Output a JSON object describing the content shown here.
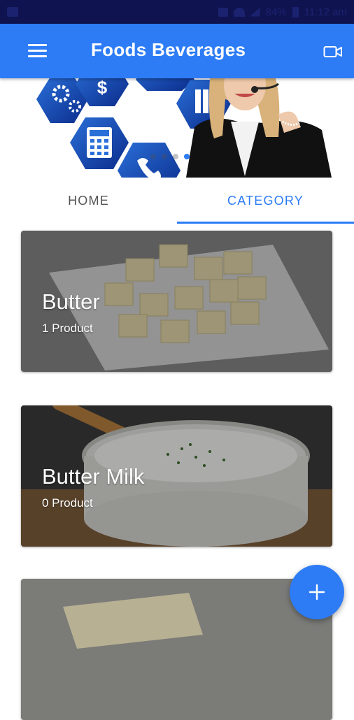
{
  "status_bar": {
    "icons": [
      "image-icon",
      "mute-icon",
      "wifi-icon",
      "signal-icon",
      "battery-icon"
    ],
    "battery": "84%",
    "time": "11:12 am"
  },
  "app_bar": {
    "title": "Foods Beverages",
    "menu_icon": "hamburger-menu-icon",
    "action_icon": "video-camera-icon",
    "color": "#2d7cf6"
  },
  "banner": {
    "icons": [
      "gears-icon",
      "dollar-icon",
      "calculator-icon",
      "binders-icon",
      "phone-icon"
    ],
    "slide_count": 4,
    "active_slide": 4
  },
  "tabs": [
    {
      "label": "HOME",
      "active": false
    },
    {
      "label": "CATEGORY",
      "active": true
    }
  ],
  "categories": [
    {
      "title": "Butter",
      "subtitle": "1 Product"
    },
    {
      "title": "Butter Milk",
      "subtitle": "0 Product"
    },
    {
      "title": "",
      "subtitle": ""
    }
  ],
  "fab": {
    "icon": "plus-icon"
  }
}
